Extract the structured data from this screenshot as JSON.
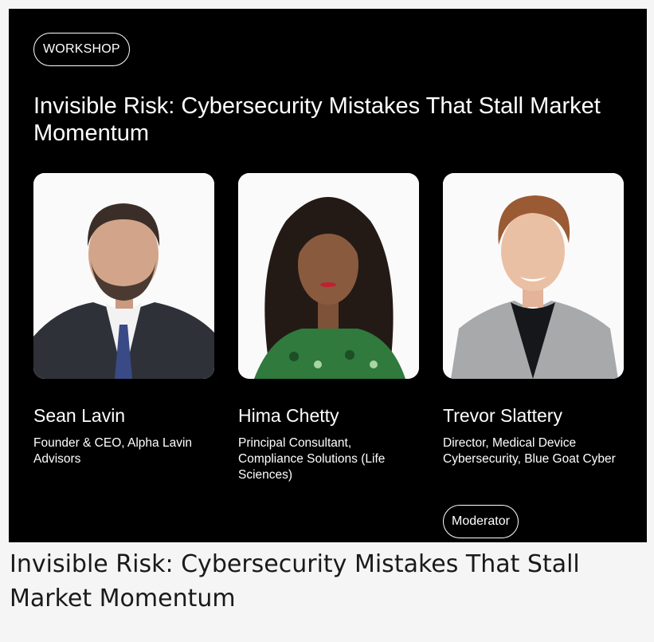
{
  "card": {
    "badge": "WORKSHOP",
    "title": "Invisible Risk: Cybersecurity Mistakes That Stall Market Momentum",
    "speakers": [
      {
        "name": "Sean Lavin",
        "role": "Founder & CEO, Alpha Lavin Advisors",
        "photo_icon": "speaker-portrait-icon"
      },
      {
        "name": "Hima Chetty",
        "role": "Principal Consultant, Compliance Solutions (Life Sciences)",
        "photo_icon": "speaker-portrait-icon"
      },
      {
        "name": "Trevor Slattery",
        "role": "Director, Medical Device Cybersecurity, Blue Goat Cyber",
        "photo_icon": "speaker-portrait-icon"
      }
    ],
    "moderator_label": "Moderator"
  },
  "caption": "Invisible Risk: Cybersecurity Mistakes That Stall Market Momentum",
  "colors": {
    "card_background": "#000000",
    "page_background": "#f5f5f5",
    "text_light": "#ffffff",
    "caption_text": "#1a1a1a"
  }
}
